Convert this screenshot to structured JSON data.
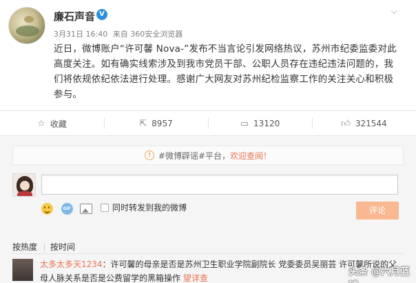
{
  "post": {
    "username": "廉石声音",
    "verified_badge": "V",
    "time": "3月31日 16:40",
    "source": "来自 360安全浏览器",
    "content": "近日，微博账户“许可馨 Nova-”发布不当言论引发网络热议，苏州市纪委监委对此高度关注。如有确实线索涉及到我市党员干部、公职人员存在违纪违法问题的，我们将依规依纪依法进行处理。感谢广大网友对苏州纪检监察工作的关注关心和积极参与。"
  },
  "actions": [
    {
      "icon": "star-icon",
      "label": "收藏"
    },
    {
      "icon": "share-icon",
      "label": "8957"
    },
    {
      "icon": "comment-icon",
      "label": "13120"
    },
    {
      "icon": "thumbs-up-icon",
      "label": "321544"
    }
  ],
  "comments": {
    "notice_prefix": "#微博辟谣#平台，",
    "notice_highlight": "欢迎查阅！",
    "sync_label": "同时转发到我的微博",
    "submit_label": "评论",
    "sort_hot": "按热度",
    "sort_time": "按时间",
    "first": {
      "nick": "太多太多天1234",
      "text": "：许可馨的母亲是否是苏州卫生职业学院副院长 党委委员吴丽芸 许可馨所说的父母人脉关系是否是公费留学的黑箱操作",
      "link": "望详查"
    }
  },
  "watermark": "头条 @六月蓝球",
  "colors": {
    "accent": "#eb7350",
    "verified": "#2b8fd9",
    "submit_disabled": "#f9b792"
  }
}
